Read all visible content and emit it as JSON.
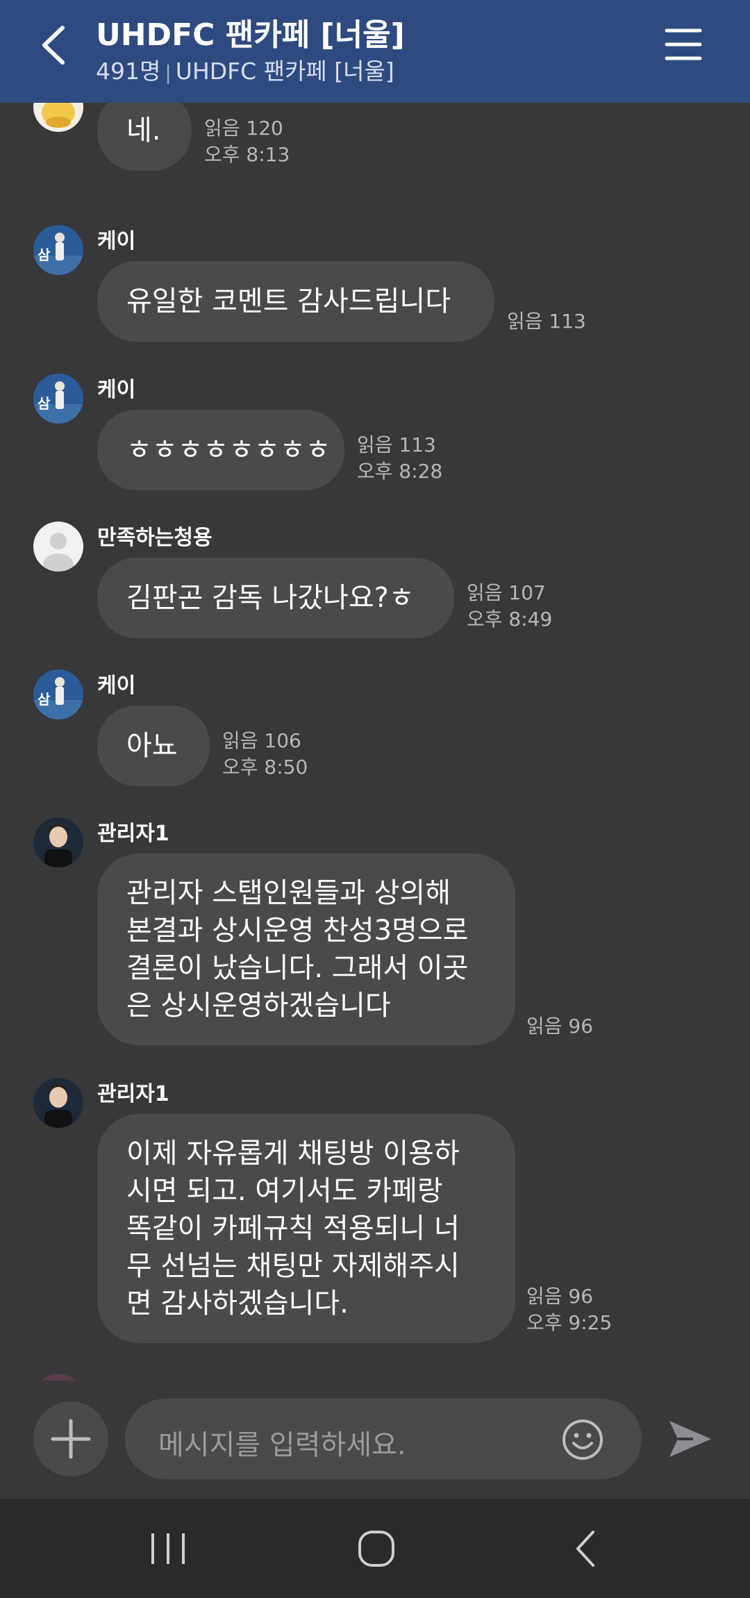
{
  "header": {
    "title": "UHDFC 팬카페 [너울]",
    "member_count": "491명",
    "subtitle": "UHDFC 팬카페 [너울]"
  },
  "messages": [
    {
      "sender": "",
      "avatar": "yellow-character-avatar",
      "text": "네.",
      "read": "읽음 120",
      "time": "오후 8:13"
    },
    {
      "sender": "케이",
      "avatar": "baseball-player-avatar",
      "text": "유일한 코멘트 감사드립니다",
      "read": "읽음 113",
      "time": ""
    },
    {
      "sender": "케이",
      "avatar": "baseball-player-avatar",
      "text": "ㅎㅎㅎㅎㅎㅎㅎㅎ",
      "read": "읽음 113",
      "time": "오후 8:28"
    },
    {
      "sender": "만족하는청용",
      "avatar": "default-user-avatar",
      "text": "김판곤 감독 나갔나요?ㅎ",
      "read": "읽음 107",
      "time": "오후 8:49"
    },
    {
      "sender": "케이",
      "avatar": "baseball-player-avatar",
      "text": "아뇨",
      "read": "읽음 106",
      "time": "오후 8:50"
    },
    {
      "sender": "관리자1",
      "avatar": "admin-portrait-avatar",
      "lines": [
        "관리자 스탭인원들과 상의해",
        "본결과 상시운영 찬성3명으로",
        "결론이 났습니다. 그래서 이곳",
        "은 상시운영하겠습니다"
      ],
      "read": "읽음 96",
      "time": ""
    },
    {
      "sender": "관리자1",
      "avatar": "admin-portrait-avatar",
      "lines": [
        "이제 자유롭게 채팅방 이용하",
        "시면 되고. 여기서도 카페랑",
        "똑같이 카페규칙 적용되니 너",
        "무 선넘는 채팅만 자제해주시",
        "면 감사하겠습니다."
      ],
      "read": "읽음 96",
      "time": "오후 9:25"
    }
  ],
  "composer": {
    "placeholder": "메시지를 입력하세요.",
    "add_icon": "plus-icon",
    "emoji_icon": "smiley-icon",
    "send_icon": "send-icon"
  },
  "navbar": {
    "recents_icon": "recent-apps-icon",
    "home_icon": "home-icon",
    "back_icon": "back-icon"
  },
  "colors": {
    "header_bg": "#2f4a80",
    "chat_bg": "#38383a",
    "bubble_bg": "#4a4a4c",
    "navbar_bg": "#2a2a2c"
  }
}
